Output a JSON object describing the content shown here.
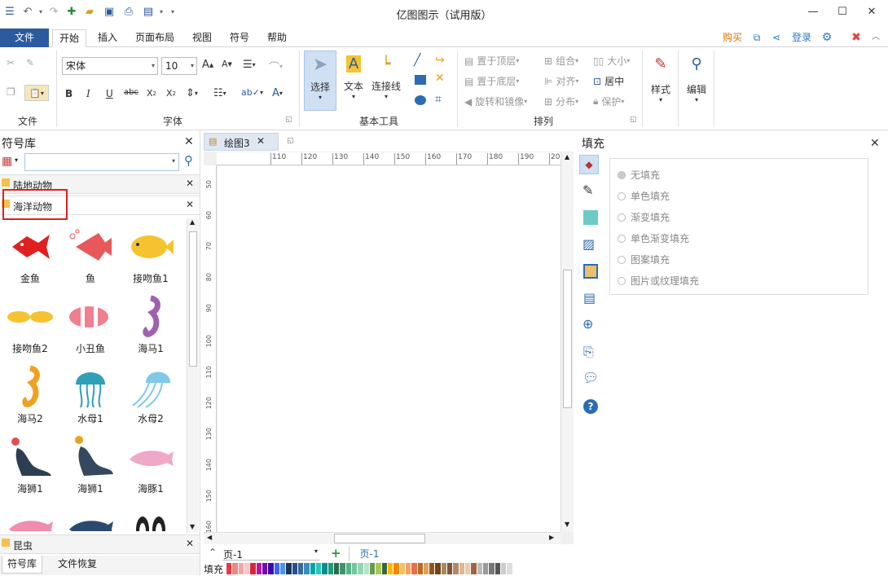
{
  "app": {
    "title": "亿图图示（试用版）"
  },
  "tabs": {
    "file": "文件",
    "home": "开始",
    "insert": "插入",
    "page_layout": "页面布局",
    "view": "视图",
    "symbol": "符号",
    "help": "帮助"
  },
  "topbar": {
    "buy": "购买",
    "login": "登录"
  },
  "ribbon": {
    "font_name": "宋体",
    "font_size": "10",
    "groups": {
      "file": "文件",
      "font": "字体",
      "basic_tools": "基本工具",
      "arrange": "排列"
    },
    "select": "选择",
    "text": "文本",
    "connector": "连接线",
    "bring_front": "置于顶层",
    "send_back": "置于底层",
    "rotate_mirror": "旋转和镜像",
    "group": "组合",
    "align": "对齐",
    "distribute": "分布",
    "size": "大小",
    "center": "居中",
    "protect": "保护",
    "style": "样式",
    "edit": "编辑"
  },
  "library": {
    "title": "符号库",
    "search_placeholder": "",
    "categories": [
      {
        "label": "陆地动物"
      },
      {
        "label": "海洋动物"
      },
      {
        "label": "昆虫"
      }
    ],
    "symbols": [
      {
        "label": "金鱼",
        "color": "#e02020"
      },
      {
        "label": "鱼",
        "color": "#e8585a"
      },
      {
        "label": "接吻鱼1",
        "color": "#f5c330"
      },
      {
        "label": "接吻鱼2",
        "color": "#f5c330"
      },
      {
        "label": "小丑鱼",
        "color": "#f08090"
      },
      {
        "label": "海马1",
        "color": "#a060b0"
      },
      {
        "label": "海马2",
        "color": "#f0a020"
      },
      {
        "label": "水母1",
        "color": "#30a0b8"
      },
      {
        "label": "水母2",
        "color": "#80c8e8"
      },
      {
        "label": "海狮1",
        "color": "#2c3e50"
      },
      {
        "label": "海狮1",
        "color": "#34495e"
      },
      {
        "label": "海豚1",
        "color": "#f0a8c8"
      }
    ],
    "bottom_tabs": {
      "library": "符号库",
      "file_recovery": "文件恢复"
    }
  },
  "document": {
    "tab": "绘图3",
    "page_select": "页-1",
    "page_tab": "页-1",
    "fill_label": "填充"
  },
  "ruler": {
    "h": [
      "110",
      "120",
      "130",
      "140",
      "150",
      "160",
      "170",
      "180",
      "190",
      "200"
    ],
    "v": [
      "50",
      "60",
      "70",
      "80",
      "90",
      "100",
      "110",
      "120",
      "130",
      "140",
      "150",
      "160"
    ]
  },
  "fill_panel": {
    "title": "填充",
    "options": [
      "无填充",
      "单色填充",
      "渐变填充",
      "单色渐变填充",
      "图案填充",
      "图片或纹理填充"
    ]
  },
  "palette": [
    "#e63946",
    "#f28482",
    "#f4a6a6",
    "#f7c6c7",
    "#d62839",
    "#b5179e",
    "#7209b7",
    "#3a0ca3",
    "#4361ee",
    "#4895ef",
    "#1d3557",
    "#2a4d8f",
    "#34699a",
    "#3c8dbc",
    "#00a6a6",
    "#2ec4b6",
    "#0f8b8d",
    "#1b9e77",
    "#2d6a4f",
    "#40916c",
    "#52b788",
    "#74c69d",
    "#95d5b2",
    "#b7e4c7",
    "#6a994e",
    "#a7c957",
    "#386641",
    "#ffb703",
    "#fb8500",
    "#e9c46a",
    "#f4a261",
    "#e76f51",
    "#bc6c25",
    "#dda15e",
    "#8d5524",
    "#6f4518",
    "#a68a64",
    "#7f5539",
    "#b08968",
    "#ddb892",
    "#e6ccb2",
    "#9c6644",
    "#bbbbbb",
    "#999999",
    "#777777",
    "#555555",
    "#cccccc",
    "#dddddd"
  ]
}
